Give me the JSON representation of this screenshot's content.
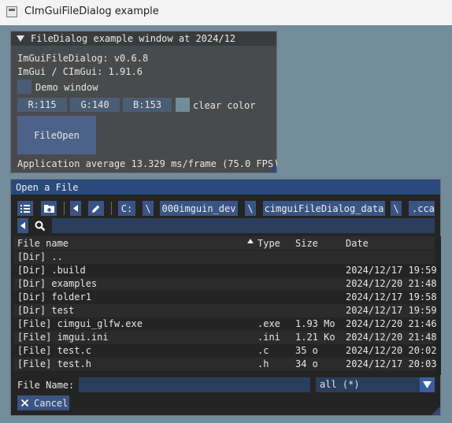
{
  "os_window": {
    "title": "CImGuiFileDialog example"
  },
  "example_window": {
    "title": "FileDialog example window at 2024/12",
    "version_line": "ImGuiFileDialog: v0.6.8",
    "imgui_line": "ImGui / CImGui: 1.91.6",
    "demo_label": "Demo window",
    "color_r": "R:115",
    "color_g": "G:140",
    "color_b": "B:153",
    "clear_color_label": "clear color",
    "clear_color_hex": "#738c99",
    "file_open_label": "FileOpen",
    "fps_line": "Application average 13.329 ms/frame (75.0 FPS)"
  },
  "file_dialog": {
    "title": "Open a File",
    "path": {
      "drive": "C:",
      "sep": "\\",
      "segments": [
        "000imguin_dev",
        "cimguiFileDialog_data",
        ".cca"
      ]
    },
    "columns": {
      "name": "File name",
      "type": "Type",
      "size": "Size",
      "date": "Date"
    },
    "files": [
      {
        "name": "[Dir] ..",
        "type": "",
        "size": "",
        "date": ""
      },
      {
        "name": "[Dir] .build",
        "type": "",
        "size": "",
        "date": "2024/12/17 19:59"
      },
      {
        "name": "[Dir] examples",
        "type": "",
        "size": "",
        "date": "2024/12/20 21:48"
      },
      {
        "name": "[Dir] folder1",
        "type": "",
        "size": "",
        "date": "2024/12/17 19:58"
      },
      {
        "name": "[Dir] test",
        "type": "",
        "size": "",
        "date": "2024/12/17 19:59"
      },
      {
        "name": "[File] cimgui_glfw.exe",
        "type": ".exe",
        "size": "1.93 Mo",
        "date": "2024/12/20 21:46"
      },
      {
        "name": "[File] imgui.ini",
        "type": ".ini",
        "size": "1.21 Ko",
        "date": "2024/12/20 21:48"
      },
      {
        "name": "[File] test.c",
        "type": ".c",
        "size": "35 o",
        "date": "2024/12/20 20:02"
      },
      {
        "name": "[File] test.h",
        "type": ".h",
        "size": "34 o",
        "date": "2024/12/17 20:03"
      }
    ],
    "file_name_label": "File Name:",
    "file_name_value": "",
    "filter_value": "all (*)",
    "cancel_label": "Cancel"
  }
}
